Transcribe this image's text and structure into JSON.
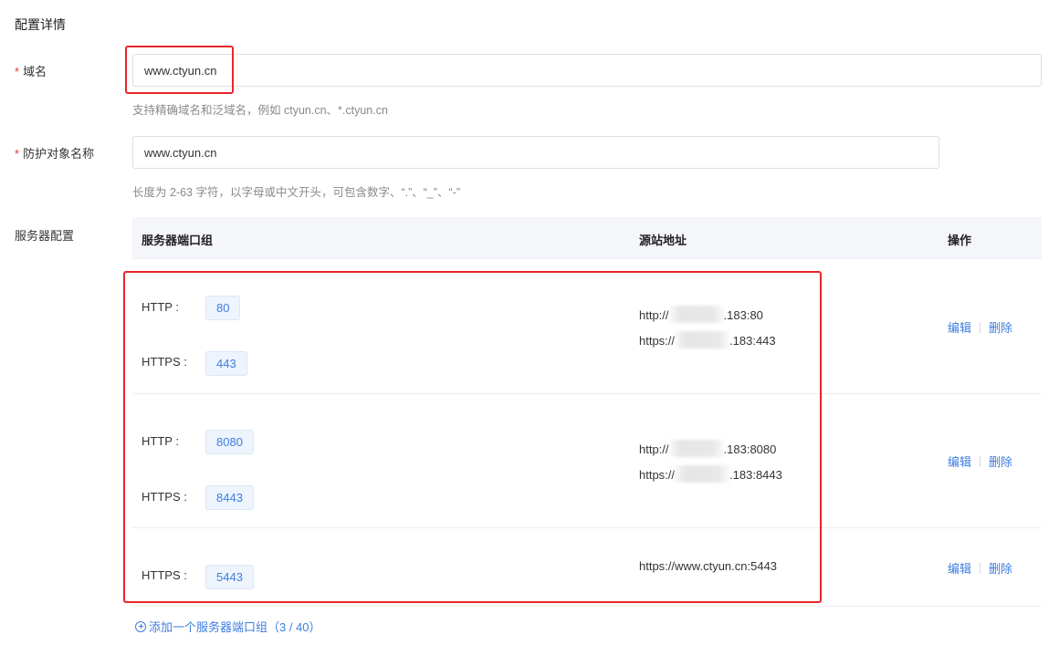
{
  "section_title": "配置详情",
  "domain": {
    "required_mark": "*",
    "label": "域名",
    "value": "www.ctyun.cn",
    "hint": "支持精确域名和泛域名，例如 ctyun.cn、*.ctyun.cn"
  },
  "protect_name": {
    "required_mark": "*",
    "label": "防护对象名称",
    "value": "www.ctyun.cn",
    "hint": "长度为 2-63 字符，以字母或中文开头，可包含数字、“.”、“_”、“-”"
  },
  "server_config": {
    "label": "服务器配置",
    "columns": [
      "服务器端口组",
      "源站地址",
      "操作"
    ],
    "rows": [
      {
        "ports": [
          {
            "protocol": "HTTP :",
            "port": "80"
          },
          {
            "protocol": "HTTPS :",
            "port": "443"
          }
        ],
        "origins": [
          {
            "prefix": "http://",
            "suffix": ".183:80"
          },
          {
            "prefix": "https://",
            "suffix": ".183:443"
          }
        ],
        "edit": "编辑",
        "delete": "删除"
      },
      {
        "ports": [
          {
            "protocol": "HTTP :",
            "port": "8080"
          },
          {
            "protocol": "HTTPS :",
            "port": "8443"
          }
        ],
        "origins": [
          {
            "prefix": "http://",
            "suffix": ".183:8080"
          },
          {
            "prefix": "https://",
            "suffix": ".183:8443"
          }
        ],
        "edit": "编辑",
        "delete": "删除"
      },
      {
        "ports": [
          {
            "protocol": "HTTPS :",
            "port": "5443"
          }
        ],
        "origins": [
          {
            "prefix": "https://www.ctyun.cn:5443",
            "suffix": ""
          }
        ],
        "edit": "编辑",
        "delete": "删除"
      }
    ],
    "add_label": "添加一个服务器端口组（3 / 40）"
  },
  "colors": {
    "accent": "#3d7de0",
    "highlight_box": "#e8262b",
    "required": "#e53935"
  }
}
